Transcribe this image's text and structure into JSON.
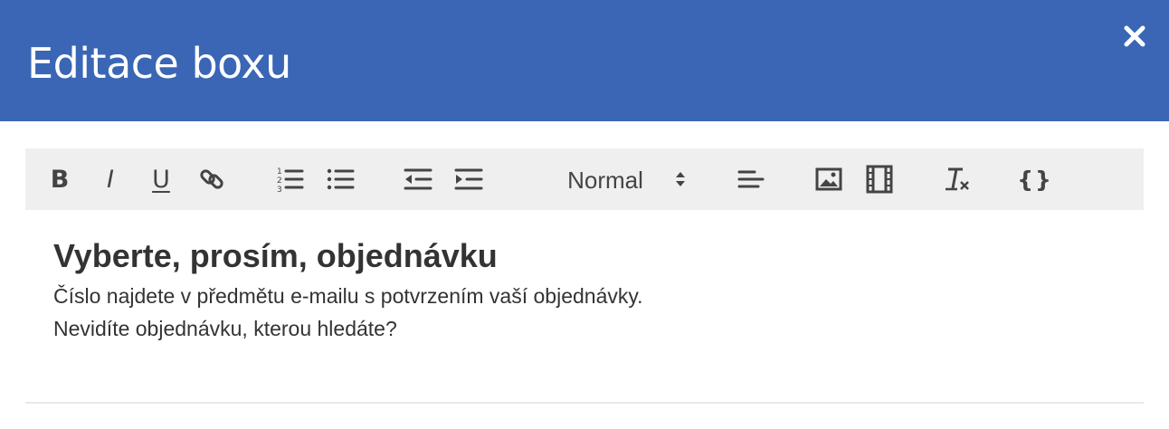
{
  "dialog": {
    "title": "Editace boxu",
    "close_icon": "close-icon",
    "header_color": "#3a66b5"
  },
  "toolbar": {
    "bold_label": "B",
    "italic_label": "I",
    "underline_label": "U",
    "link_icon": "link-icon",
    "ordered_list_icon": "ordered-list-icon",
    "bullet_list_icon": "bullet-list-icon",
    "outdent_icon": "outdent-icon",
    "indent_icon": "indent-icon",
    "header_select": {
      "selected": "Normal"
    },
    "align_icon": "align-left-icon",
    "image_icon": "image-icon",
    "video_icon": "video-icon",
    "clean_icon": "clear-format-icon",
    "code_label": "{}"
  },
  "editor": {
    "heading": "Vyberte, prosím, objednávku",
    "paragraphs": [
      "Číslo najdete v předmětu e-mailu s potvrzením vaší objednávky.",
      "Nevidíte objednávku, kterou hledáte?"
    ]
  }
}
